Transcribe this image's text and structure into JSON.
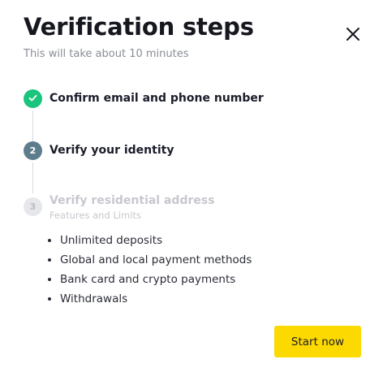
{
  "dialog": {
    "title": "Verification steps",
    "subtitle": "This will take about 10 minutes",
    "close_icon": "close-icon"
  },
  "steps": [
    {
      "status": "done",
      "marker": "check-icon",
      "label": "Confirm email and phone number"
    },
    {
      "status": "active",
      "marker": "2",
      "label": "Verify your identity"
    },
    {
      "status": "pending",
      "marker": "3",
      "label": "Verify residential address",
      "sublabel": "Features and Limits"
    }
  ],
  "features": [
    "Unlimited deposits",
    "Global and local payment methods",
    "Bank card and crypto payments",
    "Withdrawals"
  ],
  "actions": {
    "start_label": "Start now"
  },
  "colors": {
    "done": "#1bc47d",
    "active": "#5e7d8c",
    "pending": "#e6e7ea",
    "primary_button": "#fcd900"
  }
}
